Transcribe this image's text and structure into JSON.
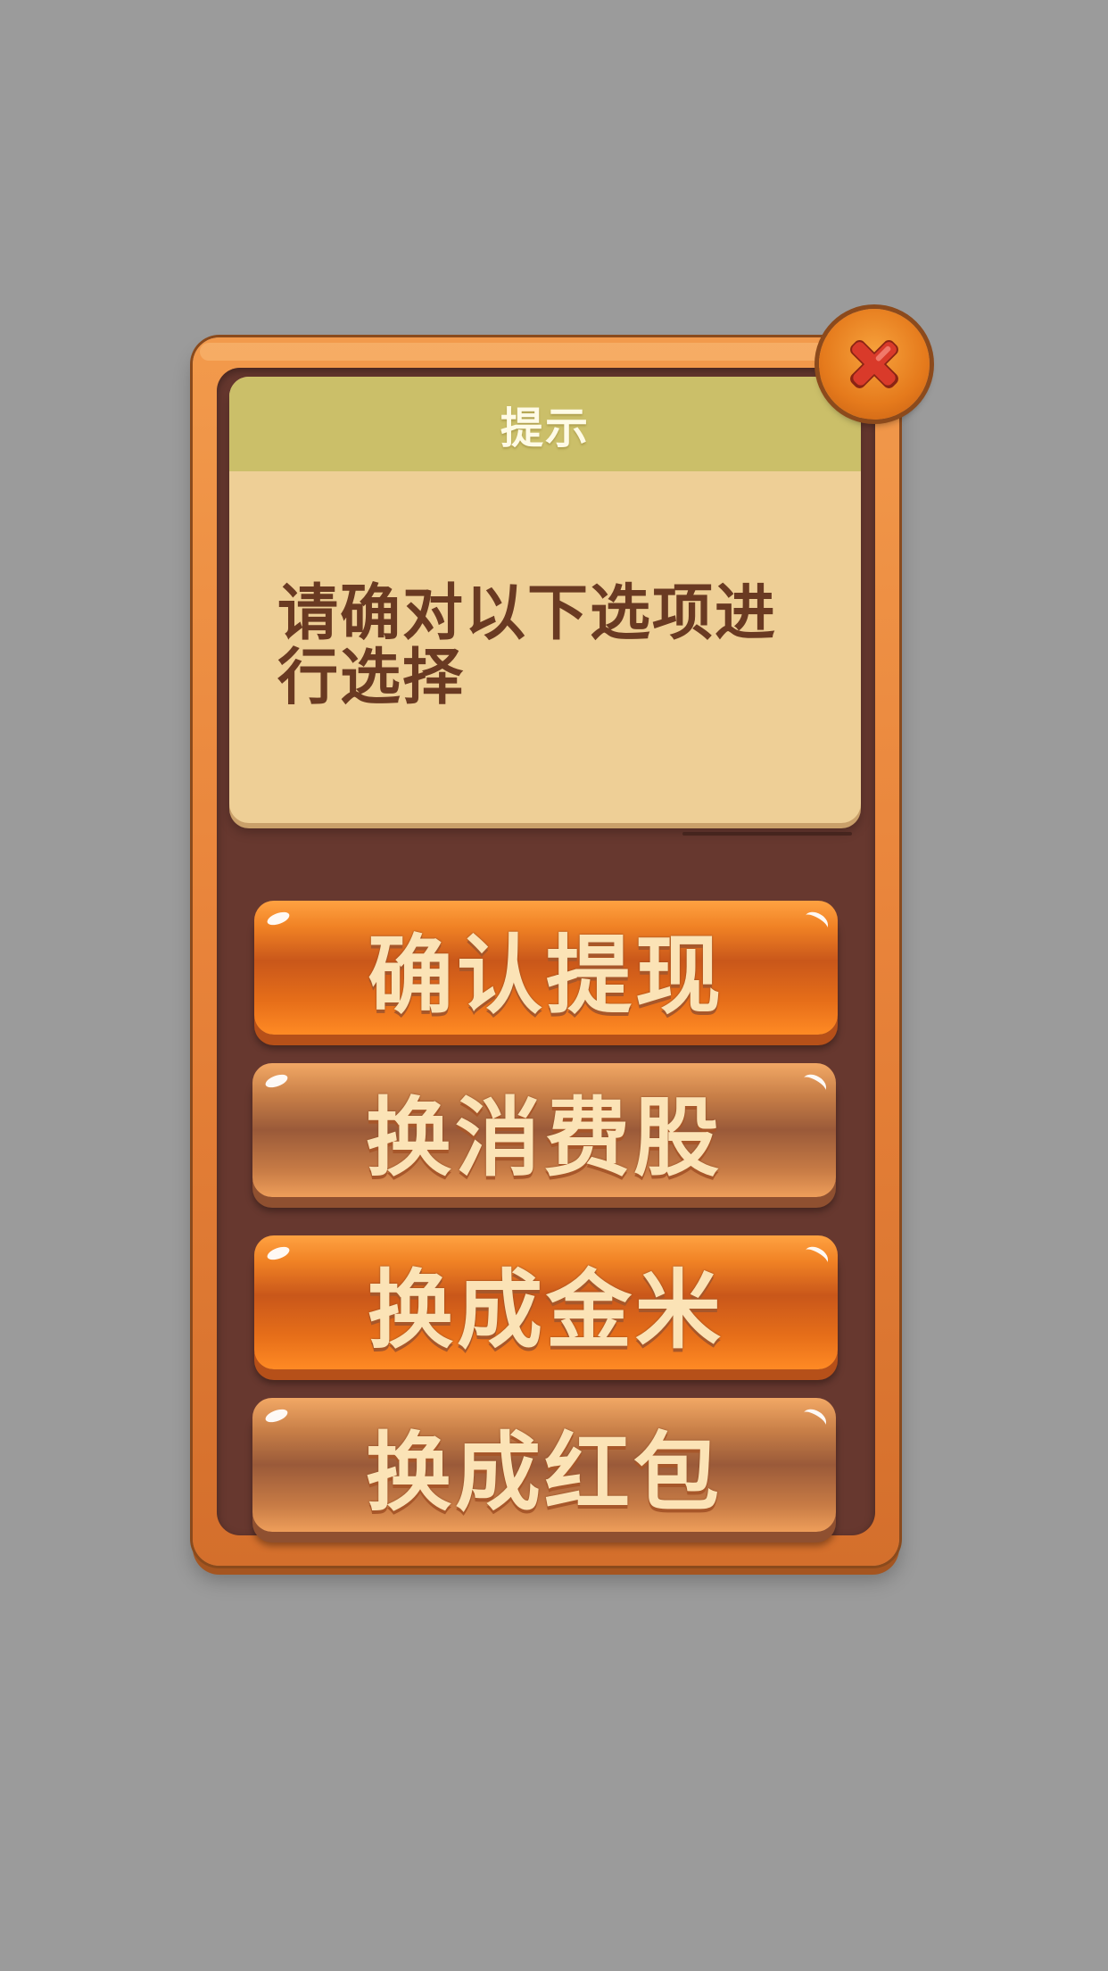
{
  "dialog": {
    "title": "提示",
    "message": "请确对以下选项进行选择",
    "close_icon": "close-icon",
    "buttons": [
      {
        "label": "确认提现",
        "style": "orange"
      },
      {
        "label": "换消费股",
        "style": "brown"
      },
      {
        "label": "换成金米",
        "style": "orange"
      },
      {
        "label": "换成红包",
        "style": "brown"
      }
    ]
  },
  "colors": {
    "background": "#9b9b9b",
    "frame_orange": "#e8833a",
    "panel_brown": "#67382f",
    "card_body": "#eecf96",
    "card_header": "#cbbf69",
    "message_text": "#6a3a22",
    "button_text": "#fbe3b6",
    "close_red": "#d93a2a"
  }
}
